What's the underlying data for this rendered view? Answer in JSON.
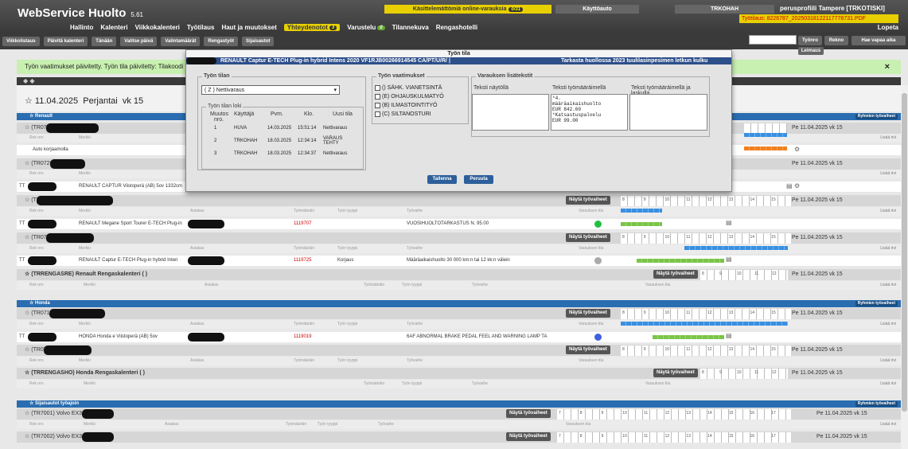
{
  "app": {
    "title": "WebService Huolto",
    "version": "5.61",
    "alert_label": "Käsittelemättömiä online-varauksia",
    "alert_count": "0/31",
    "car_button": "Käyttöauto",
    "user_code": "TRKOHAH",
    "user_profile": "perusprofiili Tampere [TRKOTISKI]",
    "order_link": "Työtilaus: 8226787_20250318122117778731.PDF",
    "logout": "Lopeta"
  },
  "nav": [
    {
      "label": "Hallinto"
    },
    {
      "label": "Kalenteri"
    },
    {
      "label": "Viikkokalenteri"
    },
    {
      "label": "Työtilaus"
    },
    {
      "label": "Haut ja muutokset"
    },
    {
      "label": "Yhteydenotot",
      "badge": "3"
    },
    {
      "label": "Varustelu",
      "badge": "0"
    },
    {
      "label": "Tilannekuva"
    },
    {
      "label": "Rengashotelli"
    }
  ],
  "toolbar": [
    "Viikkolistaus",
    "Päivitä kalenteri",
    "Tänään",
    "Valitse päivä",
    "Valintamäärät",
    "Rengastyöt",
    "Sijaisautot"
  ],
  "toolbar_right": {
    "search_label": "Työnro",
    "rekno": "Rekno",
    "search_btn": "Hae vapaa aika",
    "leimaus": "Leimaus"
  },
  "notice": {
    "text": "Työn vaatimukset päivitetty. Työn tila päivitetty: Tilakoodi p",
    "close": "×"
  },
  "day": {
    "date": "11.04.2025",
    "weekday": "Perjantai",
    "week": "vk 15"
  },
  "cols": {
    "rek": "Rek nro",
    "merkki": "Merkki",
    "asiakas": "Asiakas",
    "tyomaarain": "Työmääräin",
    "tyyppi": "Työn tyyppi",
    "tyovaihe": "Työvaihe",
    "varaus": "Varauksen tila",
    "lisaa": "Lisää rivi",
    "nayta": "Näytä työvaiheet",
    "ryhmien": "Ryhmien työvaiheet"
  },
  "renault": {
    "title": "Renault",
    "r1": {
      "head": "(TR0707",
      "date": "Pe 11.04.2025 vk 15",
      "text": "Auto korjaamolla"
    },
    "r2": {
      "head": "(TR0720",
      "date": "Pe 11.04.2025 vk 15",
      "mark": "TT",
      "car": "RENAULT CAPTUR Viistoperä (AB) 5ov 1332cm"
    },
    "r3": {
      "head": "(TR07",
      "date": "Pe 11.04.2025 vk 15",
      "mark": "TT",
      "car": "RENAULT Megane Sport Tourer E-TECH Plug-in",
      "order": "1119707",
      "step": "VUOSIHUOLTOTARKASTUS N. 95.00"
    },
    "r4": {
      "head": "(TR0728",
      "date": "Pe 11.04.2025 vk 15",
      "mark": "TT",
      "car": "RENAULT Captur E-TECH Plug-in hybrid Inten",
      "order": "1119725",
      "type": "Korjaus",
      "step": "Määräaikaishuolto 30 000 km:n tai 12 kk:n välein"
    },
    "rengas": {
      "head": "(TRRENGASRE) Renault Rengaskalenteri ( )",
      "date": "Pe 11.04.2025 vk 15"
    }
  },
  "honda": {
    "title": "Honda",
    "r1": {
      "head": "(TR0711",
      "date": "Pe 11.04.2025 vk 15",
      "mark": "TT",
      "car": "HONDA Honda e Viistoperä (AB) 5ov",
      "order": "1119019",
      "step": "6AF ABNORMAL BRAKE PEDAL FEEL AND WARNING LAMP TA"
    },
    "r2": {
      "head": "(TR072",
      "date": "Pe 11.04.2025 vk 15"
    },
    "rengas": {
      "head": "(TRRENGASHO) Honda Rengaskalenteri ( )",
      "date": "Pe 11.04.2025 vk 15"
    }
  },
  "sijais": {
    "title": "Sijaisautot työajoin",
    "r1": {
      "head": "(TR7001) Volvo EX3",
      "date": "Pe 11.04.2025 vk 15"
    },
    "r2": {
      "head": "(TR7002) Volvo EX3",
      "date": "Pe 11.04.2025 vk 15"
    }
  },
  "ticks_a": [
    "8",
    "9",
    "10",
    "11",
    "12",
    "13",
    "14",
    "15"
  ],
  "ticks_b": [
    "7",
    "8",
    "9",
    "10",
    "11",
    "12",
    "13",
    "14",
    "15",
    "16",
    "17"
  ],
  "modal": {
    "title": "Työn tila",
    "vehicle": "RENAULT Captur E-TECH Plug-in hybrid Intens 2020 VF1RJB00266914545 CA/PT/U/R/ |",
    "note": "Tarkasta huollossa 2023 tuulilasinpesimen letkun kulku",
    "tila_label": "Työn tilan",
    "tila_value": "( Z ) Nettivaraus",
    "loki_label": "Työn tilan loki",
    "loki_cols": [
      "Muutos nro.",
      "Käyttäjä",
      "Pvm.",
      "Klo.",
      "Uusi tila"
    ],
    "loki": [
      {
        "n": "1",
        "user": "HUVA",
        "date": "14.03.2025",
        "time": "15:51:14",
        "state": "Nettivaraus"
      },
      {
        "n": "2",
        "user": "TRKOHAH",
        "date": "18.03.2025",
        "time": "12:34:14",
        "state": "VARAUS TEHTY"
      },
      {
        "n": "3",
        "user": "TRKOHAH",
        "date": "18.03.2025",
        "time": "12:34:37",
        "state": "Nettivaraus"
      }
    ],
    "vaat_label": "Työn vaatimukset",
    "vaat": [
      "() SÄHK. VIANETSINTÄ",
      "(E) OHJAUSKULMATYÖ",
      "(B) ILMASTOINTITYÖ",
      "(C) SILTANOSTURI"
    ],
    "lisa_label": "Varauksen lisätekstit",
    "lisa_cols": [
      "Teksti näytöllä",
      "Teksti työmääräimellä",
      "Teksti työmääräimellä ja laskulla"
    ],
    "lisa_text": "*4.\nmääräaikaishuolto\nEUR 842.60\n*Katsastuspalvelu\nEUR 99.00",
    "save": "Tallenna",
    "cancel": "Peruuta"
  }
}
